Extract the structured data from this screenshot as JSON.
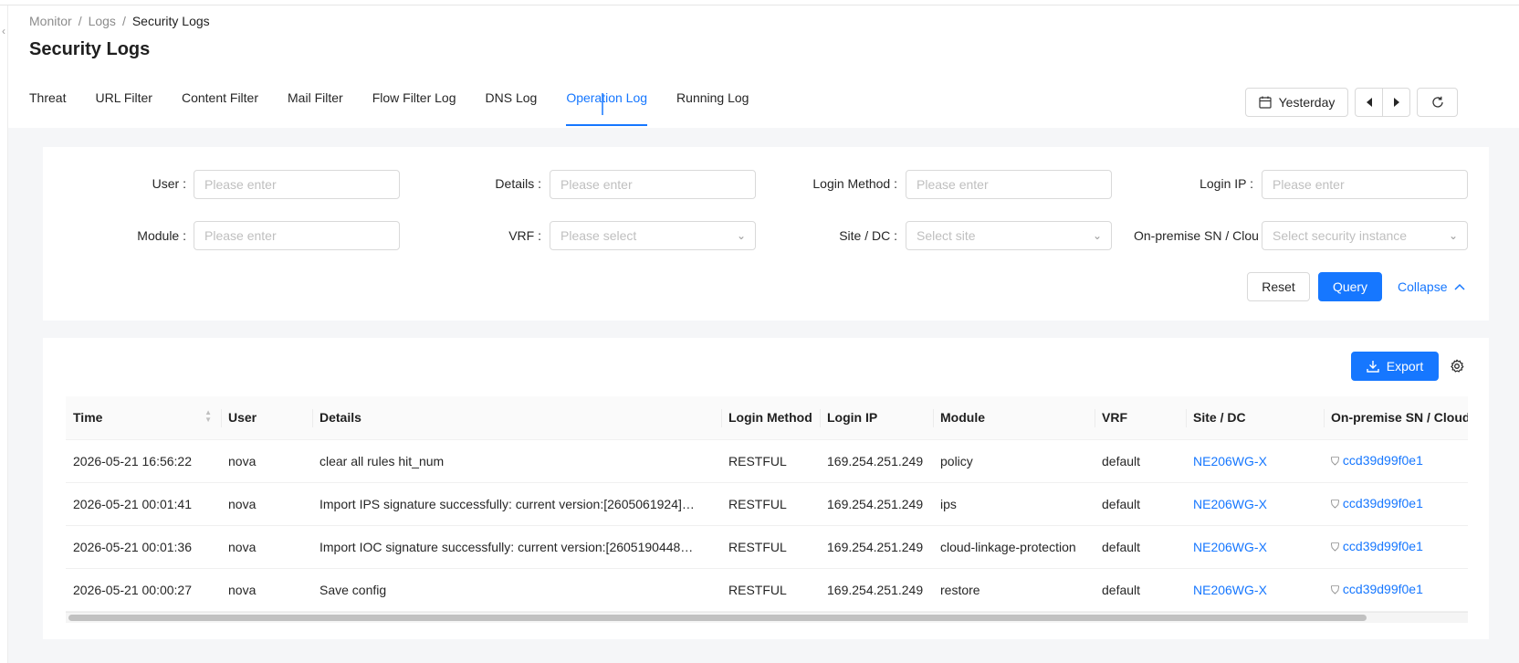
{
  "breadcrumb": [
    "Monitor",
    "Logs",
    "Security Logs"
  ],
  "page_title": "Security Logs",
  "tabs": [
    {
      "label": "Threat"
    },
    {
      "label": "URL Filter"
    },
    {
      "label": "Content Filter"
    },
    {
      "label": "Mail Filter"
    },
    {
      "label": "Flow Filter Log"
    },
    {
      "label": "DNS Log"
    },
    {
      "label": "Operation Log",
      "active": true
    },
    {
      "label": "Running Log"
    }
  ],
  "toolbar": {
    "date_label": "Yesterday"
  },
  "filters": {
    "user": {
      "label": "User",
      "placeholder": "Please enter"
    },
    "details": {
      "label": "Details",
      "placeholder": "Please enter"
    },
    "login_method": {
      "label": "Login Method",
      "placeholder": "Please enter"
    },
    "login_ip": {
      "label": "Login IP",
      "placeholder": "Please enter"
    },
    "module": {
      "label": "Module",
      "placeholder": "Please enter"
    },
    "vrf": {
      "label": "VRF",
      "placeholder": "Please select"
    },
    "site_dc": {
      "label": "Site / DC",
      "placeholder": "Select site"
    },
    "onprem_sn": {
      "label": "On-premise SN / Clou",
      "placeholder": "Select security instance"
    }
  },
  "filter_actions": {
    "reset": "Reset",
    "query": "Query",
    "collapse": "Collapse"
  },
  "table_actions": {
    "export": "Export"
  },
  "table": {
    "columns": [
      "Time",
      "User",
      "Details",
      "Login Method",
      "Login IP",
      "Module",
      "VRF",
      "Site / DC",
      "On-premise SN / Cloud"
    ],
    "rows": [
      [
        "2026-05-21 16:56:22",
        "nova",
        "clear all rules hit_num",
        "RESTFUL",
        "169.254.251.249",
        "policy",
        "default",
        "NE206WG-X",
        "ccd39d99f0e1"
      ],
      [
        "2026-05-21 00:01:41",
        "nova",
        "Import IPS signature successfully: current version:[2605061924]…",
        "RESTFUL",
        "169.254.251.249",
        "ips",
        "default",
        "NE206WG-X",
        "ccd39d99f0e1"
      ],
      [
        "2026-05-21 00:01:36",
        "nova",
        "Import IOC signature successfully: current version:[2605190448…",
        "RESTFUL",
        "169.254.251.249",
        "cloud-linkage-protection",
        "default",
        "NE206WG-X",
        "ccd39d99f0e1"
      ],
      [
        "2026-05-21 00:00:27",
        "nova",
        "Save config",
        "RESTFUL",
        "169.254.251.249",
        "restore",
        "default",
        "NE206WG-X",
        "ccd39d99f0e1"
      ]
    ]
  },
  "colors": {
    "accent": "#1677ff",
    "background": "#f5f6f8"
  }
}
